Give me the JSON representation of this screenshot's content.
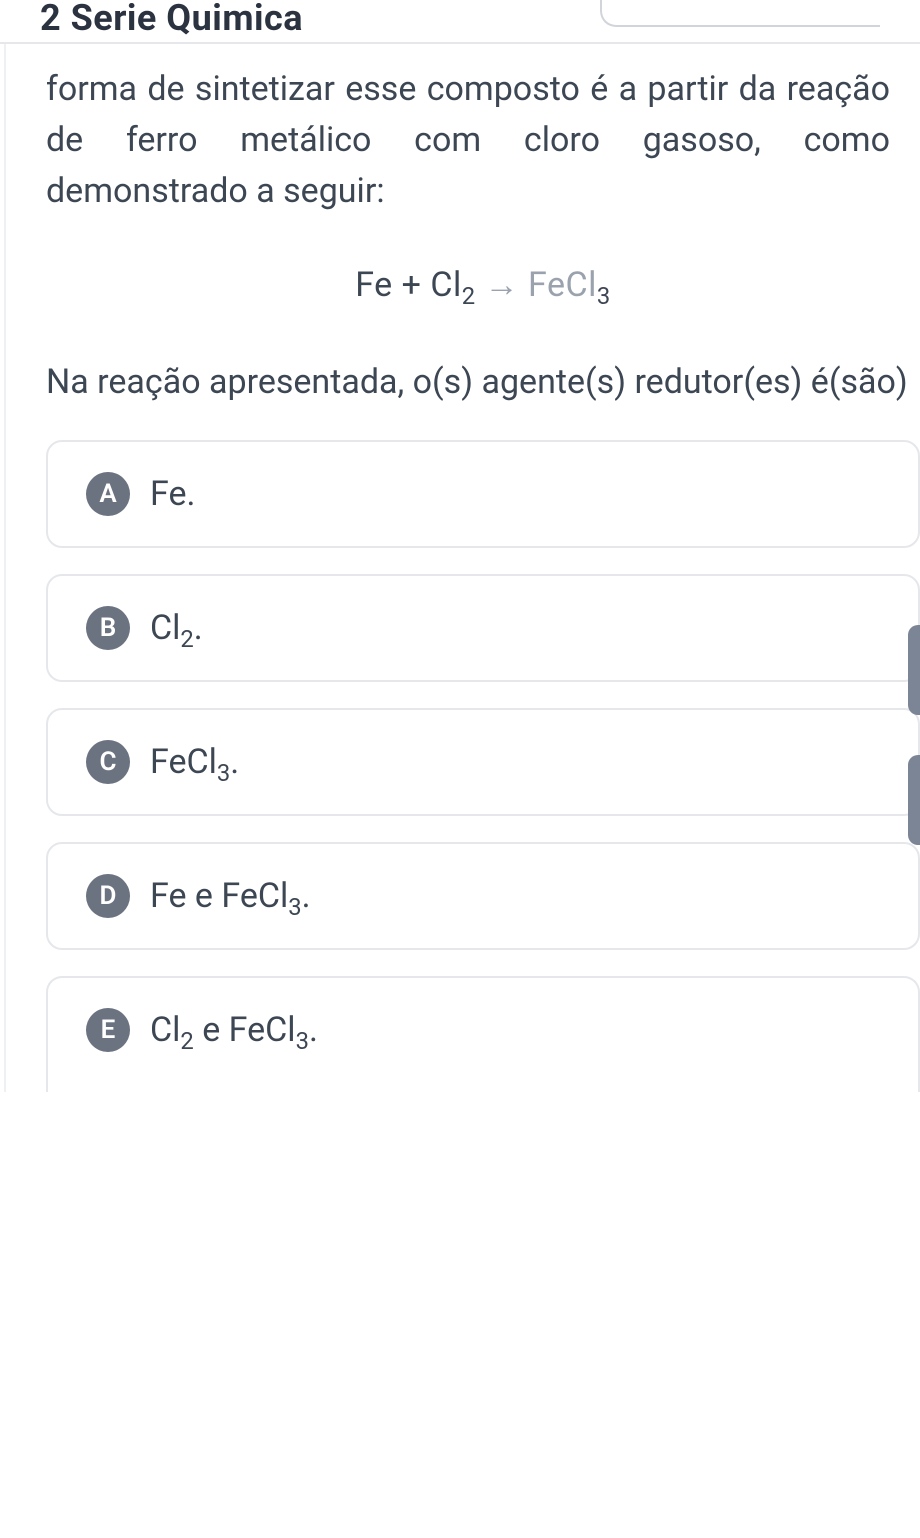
{
  "header": {
    "crumbs": "2 Serie Quimica"
  },
  "question": {
    "paragraph1": "forma de sintetizar esse composto é a partir da reação de ferro metálico com cloro gasoso, como demonstrado a seguir:",
    "reaction_lhs": "Fe + Cl",
    "reaction_sub1": "2",
    "reaction_mid": " → FeCl",
    "reaction_sub2": "3",
    "paragraph2": "Na reação apresentada, o(s) agente(s) redutor(es) é(são)"
  },
  "options": {
    "a": {
      "letter": "A",
      "text": "Fe."
    },
    "b": {
      "letter": "B",
      "pre": "Cl",
      "sub": "2",
      "post": "."
    },
    "c": {
      "letter": "C",
      "pre": "FeCl",
      "sub": "3",
      "post": "."
    },
    "d": {
      "letter": "D",
      "pre": "Fe e FeCl",
      "sub": "3",
      "post": "."
    },
    "e": {
      "letter": "E",
      "pre1": "Cl",
      "sub1": "2",
      "mid": " e FeCl",
      "sub2": "3",
      "post": "."
    }
  }
}
